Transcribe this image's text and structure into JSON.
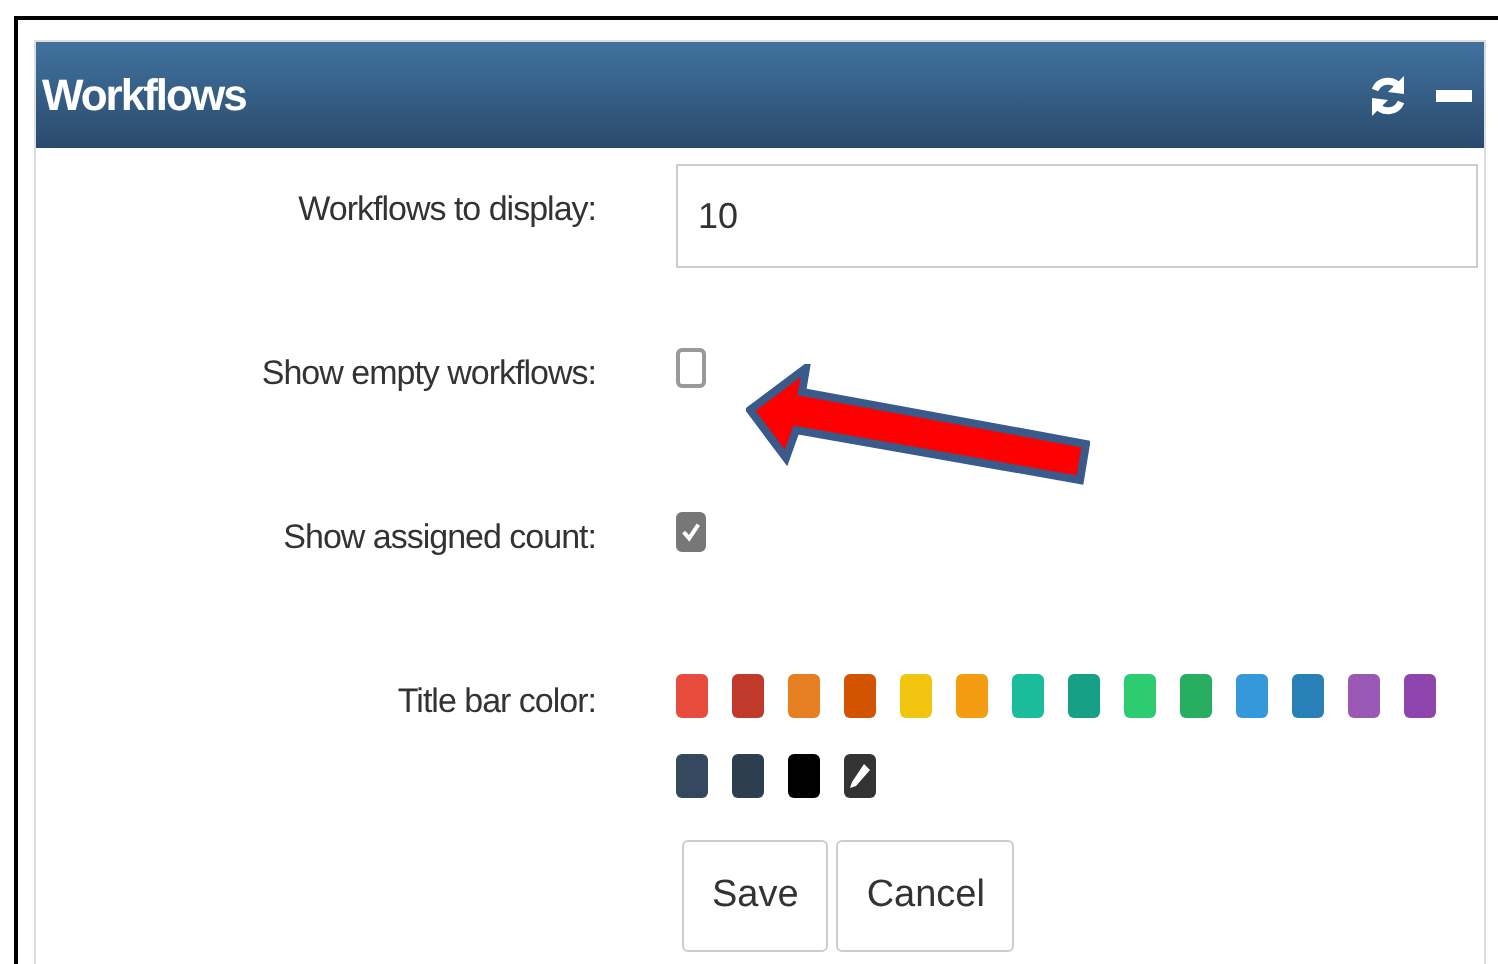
{
  "panel": {
    "title": "Workflows"
  },
  "fields": [
    {
      "kind": "number",
      "label": "Workflows to display:",
      "value": "10"
    },
    {
      "kind": "checkbox",
      "label": "Show empty workflows:",
      "checked": false
    },
    {
      "kind": "checkbox",
      "label": "Show assigned count:",
      "checked": true
    },
    {
      "kind": "colors",
      "label": "Title bar color:"
    }
  ],
  "swatches": [
    {
      "kind": "color",
      "color": "#e74c3c"
    },
    {
      "kind": "color",
      "color": "#c0392b"
    },
    {
      "kind": "color",
      "color": "#e67e22"
    },
    {
      "kind": "color",
      "color": "#d35400"
    },
    {
      "kind": "color",
      "color": "#f1c40f"
    },
    {
      "kind": "color",
      "color": "#f39c12"
    },
    {
      "kind": "color",
      "color": "#1abc9c"
    },
    {
      "kind": "color",
      "color": "#16a085"
    },
    {
      "kind": "color",
      "color": "#2ecc71"
    },
    {
      "kind": "color",
      "color": "#27ae60"
    },
    {
      "kind": "color",
      "color": "#3498db"
    },
    {
      "kind": "color",
      "color": "#2980b9"
    },
    {
      "kind": "color",
      "color": "#9b59b6"
    },
    {
      "kind": "color",
      "color": "#8e44ad"
    },
    {
      "kind": "color",
      "color": "#34495e"
    },
    {
      "kind": "color",
      "color": "#2c3e50"
    },
    {
      "kind": "color",
      "color": "#000000"
    },
    {
      "kind": "custom",
      "color": "#333333"
    }
  ],
  "buttons": [
    "Save",
    "Cancel"
  ]
}
